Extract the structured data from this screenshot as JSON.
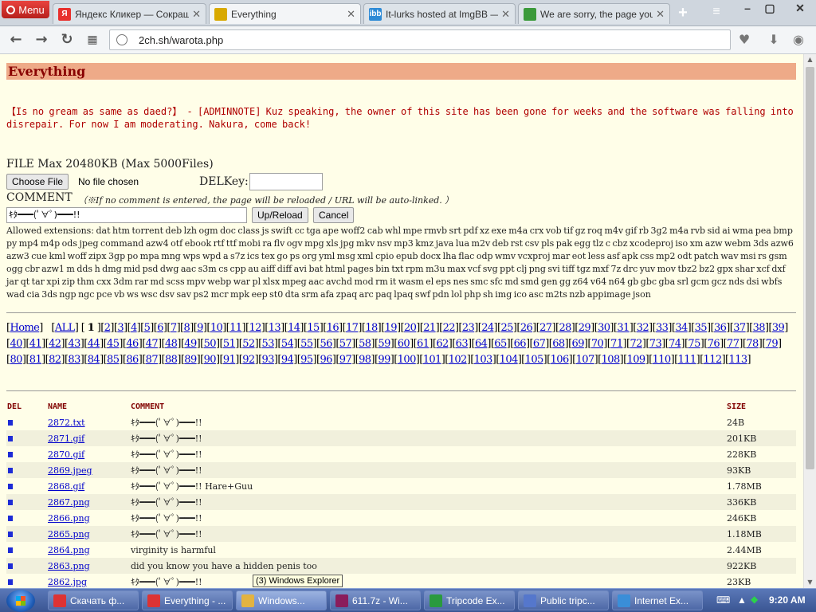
{
  "browser": {
    "menu_label": "Menu",
    "tabs": [
      {
        "title": "Яндекс Кликер — Сокращ",
        "icon": "yandex-icon",
        "color": "#e8302d",
        "glyph": "Я",
        "active": false
      },
      {
        "title": "Everything",
        "icon": "page-icon",
        "color": "#d8a900",
        "glyph": "",
        "active": true
      },
      {
        "title": "It-lurks hosted at ImgBB —",
        "icon": "imgbb-icon",
        "color": "#2d8ad6",
        "glyph": "ibb",
        "active": false
      },
      {
        "title": "We are sorry, the page you",
        "icon": "microsoft-icon",
        "color": "#3b9a3b",
        "glyph": "",
        "active": false
      }
    ],
    "url": "2ch.sh/warota.php"
  },
  "page": {
    "title": "Everything",
    "notice": "【Is no gream as same as daed?】 - [ADMINNOTE] Kuz speaking, the owner of this site has been gone for weeks and the software was falling into disrepair. For now I am moderating. Nakura, come back!",
    "file_label": "FILE Max 20480KB (Max 5000Files)",
    "choose_file": "Choose File",
    "no_file": "No file chosen",
    "delkey_label": "DELKey:",
    "comment_label": "COMMENT",
    "comment_note": "（※If no comment is entered, the page will be reloaded / URL will be auto-linked. ）",
    "comment_value": "ｷﾀ━━━(ﾟ∀ﾟ)━━━!!",
    "upload_button": "Up/Reload",
    "cancel_button": "Cancel",
    "allowed": "Allowed extensions:  dat htm torrent deb lzh ogm doc class js swift cc tga ape woff2 cab whl mpe rmvb srt pdf xz exe m4a crx vob tif gz roq m4v gif rb 3g2 m4a rvb sid ai wma pea bmp py mp4 m4p ods jpeg command azw4 otf ebook rtf ttf mobi ra flv ogv mpg xls jpg mkv nsv mp3 kmz java lua m2v deb rst csv pls pak egg tlz c cbz xcodeproj iso xm azw webm 3ds azw6 azw3 cue kml woff zipx 3gp po mpa mng wps wpd a s7z ics tex go ps org yml msg xml cpio epub docx lha flac odp wmv vcxproj mar eot less asf apk css mp2 odt patch wav msi rs gsm ogg cbr azw1 m dds h dmg mid psd dwg aac s3m cs cpp au aiff diff avi bat html pages bin txt rpm m3u max vcf svg ppt clj png svi tiff tgz mxf 7z drc yuv mov tbz2 bz2 gpx shar xcf dxf jar qt tar xpi zip thm cxx 3dm rar md scss mpv webp war pl xlsx mpeg aac avchd mod rm it wasm el eps nes smc sfc md smd gen gg z64 v64 n64 gb gbc gba srl gcm gcz nds dsi wbfs wad cia 3ds ngp ngc pce vb ws wsc dsv sav ps2 mcr mpk eep st0 dta srm afa zpaq arc paq lpaq swf pdn lol php sh img ico asc m2ts nzb appimage json",
    "pager": {
      "home": "Home",
      "all": "ALL",
      "current": "1",
      "last_page": 113
    },
    "table": {
      "headers": [
        "DEL",
        "NAME",
        "COMMENT",
        "SIZE"
      ],
      "rows": [
        {
          "name": "2872.txt",
          "comment": "ｷﾀ━━━(ﾟ∀ﾟ)━━━!!",
          "size": "24B"
        },
        {
          "name": "2871.gif",
          "comment": "ｷﾀ━━━(ﾟ∀ﾟ)━━━!!",
          "size": "201KB"
        },
        {
          "name": "2870.gif",
          "comment": "ｷﾀ━━━(ﾟ∀ﾟ)━━━!!",
          "size": "228KB"
        },
        {
          "name": "2869.jpeg",
          "comment": "ｷﾀ━━━(ﾟ∀ﾟ)━━━!!",
          "size": "93KB"
        },
        {
          "name": "2868.gif",
          "comment": "ｷﾀ━━━(ﾟ∀ﾟ)━━━!! Hare+Guu",
          "size": "1.78MB"
        },
        {
          "name": "2867.png",
          "comment": "ｷﾀ━━━(ﾟ∀ﾟ)━━━!!",
          "size": "336KB"
        },
        {
          "name": "2866.png",
          "comment": "ｷﾀ━━━(ﾟ∀ﾟ)━━━!!",
          "size": "246KB"
        },
        {
          "name": "2865.png",
          "comment": "ｷﾀ━━━(ﾟ∀ﾟ)━━━!!",
          "size": "1.18MB"
        },
        {
          "name": "2864.png",
          "comment": "virginity is harmful",
          "size": "2.44MB"
        },
        {
          "name": "2863.png",
          "comment": "did you know you have a hidden penis too",
          "size": "922KB"
        },
        {
          "name": "2862.jpg",
          "comment": "ｷﾀ━━━(ﾟ∀ﾟ)━━━!!",
          "size": "23KB"
        }
      ]
    }
  },
  "tooltip": "(3) Windows Explorer",
  "taskbar": {
    "items": [
      {
        "label": "Скачать ф...",
        "icon": "opera-icon",
        "color": "#d33",
        "active": false
      },
      {
        "label": "Everything - ...",
        "icon": "opera-icon",
        "color": "#d33",
        "active": false
      },
      {
        "label": "Windows...",
        "icon": "folder-icon",
        "color": "#e3b340",
        "active": true
      },
      {
        "label": "611.7z - Wi...",
        "icon": "archive-icon",
        "color": "#8a1d5c",
        "active": false
      },
      {
        "label": "Tripcode Ex...",
        "icon": "tripcode-icon",
        "color": "#2a9a3e",
        "active": false
      },
      {
        "label": "Public tripc...",
        "icon": "document-icon",
        "color": "#5577cc",
        "active": false
      },
      {
        "label": "Internet Ex...",
        "icon": "ie-icon",
        "color": "#3a8ed8",
        "active": false
      }
    ],
    "time": "9:20 AM"
  }
}
